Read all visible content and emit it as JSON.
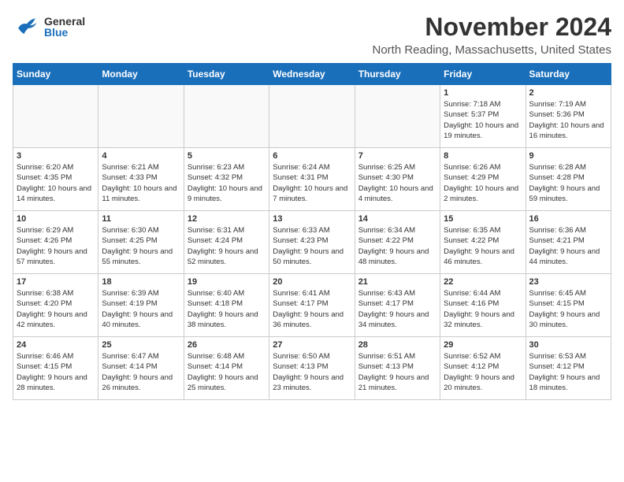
{
  "header": {
    "month_title": "November 2024",
    "location": "North Reading, Massachusetts, United States",
    "logo_general": "General",
    "logo_blue": "Blue"
  },
  "weekdays": [
    "Sunday",
    "Monday",
    "Tuesday",
    "Wednesday",
    "Thursday",
    "Friday",
    "Saturday"
  ],
  "weeks": [
    [
      {
        "day": "",
        "info": ""
      },
      {
        "day": "",
        "info": ""
      },
      {
        "day": "",
        "info": ""
      },
      {
        "day": "",
        "info": ""
      },
      {
        "day": "",
        "info": ""
      },
      {
        "day": "1",
        "info": "Sunrise: 7:18 AM\nSunset: 5:37 PM\nDaylight: 10 hours and 19 minutes."
      },
      {
        "day": "2",
        "info": "Sunrise: 7:19 AM\nSunset: 5:36 PM\nDaylight: 10 hours and 16 minutes."
      }
    ],
    [
      {
        "day": "3",
        "info": "Sunrise: 6:20 AM\nSunset: 4:35 PM\nDaylight: 10 hours and 14 minutes."
      },
      {
        "day": "4",
        "info": "Sunrise: 6:21 AM\nSunset: 4:33 PM\nDaylight: 10 hours and 11 minutes."
      },
      {
        "day": "5",
        "info": "Sunrise: 6:23 AM\nSunset: 4:32 PM\nDaylight: 10 hours and 9 minutes."
      },
      {
        "day": "6",
        "info": "Sunrise: 6:24 AM\nSunset: 4:31 PM\nDaylight: 10 hours and 7 minutes."
      },
      {
        "day": "7",
        "info": "Sunrise: 6:25 AM\nSunset: 4:30 PM\nDaylight: 10 hours and 4 minutes."
      },
      {
        "day": "8",
        "info": "Sunrise: 6:26 AM\nSunset: 4:29 PM\nDaylight: 10 hours and 2 minutes."
      },
      {
        "day": "9",
        "info": "Sunrise: 6:28 AM\nSunset: 4:28 PM\nDaylight: 9 hours and 59 minutes."
      }
    ],
    [
      {
        "day": "10",
        "info": "Sunrise: 6:29 AM\nSunset: 4:26 PM\nDaylight: 9 hours and 57 minutes."
      },
      {
        "day": "11",
        "info": "Sunrise: 6:30 AM\nSunset: 4:25 PM\nDaylight: 9 hours and 55 minutes."
      },
      {
        "day": "12",
        "info": "Sunrise: 6:31 AM\nSunset: 4:24 PM\nDaylight: 9 hours and 52 minutes."
      },
      {
        "day": "13",
        "info": "Sunrise: 6:33 AM\nSunset: 4:23 PM\nDaylight: 9 hours and 50 minutes."
      },
      {
        "day": "14",
        "info": "Sunrise: 6:34 AM\nSunset: 4:22 PM\nDaylight: 9 hours and 48 minutes."
      },
      {
        "day": "15",
        "info": "Sunrise: 6:35 AM\nSunset: 4:22 PM\nDaylight: 9 hours and 46 minutes."
      },
      {
        "day": "16",
        "info": "Sunrise: 6:36 AM\nSunset: 4:21 PM\nDaylight: 9 hours and 44 minutes."
      }
    ],
    [
      {
        "day": "17",
        "info": "Sunrise: 6:38 AM\nSunset: 4:20 PM\nDaylight: 9 hours and 42 minutes."
      },
      {
        "day": "18",
        "info": "Sunrise: 6:39 AM\nSunset: 4:19 PM\nDaylight: 9 hours and 40 minutes."
      },
      {
        "day": "19",
        "info": "Sunrise: 6:40 AM\nSunset: 4:18 PM\nDaylight: 9 hours and 38 minutes."
      },
      {
        "day": "20",
        "info": "Sunrise: 6:41 AM\nSunset: 4:17 PM\nDaylight: 9 hours and 36 minutes."
      },
      {
        "day": "21",
        "info": "Sunrise: 6:43 AM\nSunset: 4:17 PM\nDaylight: 9 hours and 34 minutes."
      },
      {
        "day": "22",
        "info": "Sunrise: 6:44 AM\nSunset: 4:16 PM\nDaylight: 9 hours and 32 minutes."
      },
      {
        "day": "23",
        "info": "Sunrise: 6:45 AM\nSunset: 4:15 PM\nDaylight: 9 hours and 30 minutes."
      }
    ],
    [
      {
        "day": "24",
        "info": "Sunrise: 6:46 AM\nSunset: 4:15 PM\nDaylight: 9 hours and 28 minutes."
      },
      {
        "day": "25",
        "info": "Sunrise: 6:47 AM\nSunset: 4:14 PM\nDaylight: 9 hours and 26 minutes."
      },
      {
        "day": "26",
        "info": "Sunrise: 6:48 AM\nSunset: 4:14 PM\nDaylight: 9 hours and 25 minutes."
      },
      {
        "day": "27",
        "info": "Sunrise: 6:50 AM\nSunset: 4:13 PM\nDaylight: 9 hours and 23 minutes."
      },
      {
        "day": "28",
        "info": "Sunrise: 6:51 AM\nSunset: 4:13 PM\nDaylight: 9 hours and 21 minutes."
      },
      {
        "day": "29",
        "info": "Sunrise: 6:52 AM\nSunset: 4:12 PM\nDaylight: 9 hours and 20 minutes."
      },
      {
        "day": "30",
        "info": "Sunrise: 6:53 AM\nSunset: 4:12 PM\nDaylight: 9 hours and 18 minutes."
      }
    ]
  ]
}
